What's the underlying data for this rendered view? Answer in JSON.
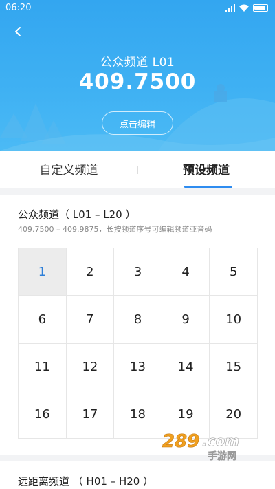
{
  "status": {
    "time": "06:20"
  },
  "header": {
    "channel_title": "公众频道 L01",
    "frequency": "409.7500",
    "edit_label": "点击编辑"
  },
  "tabs": [
    {
      "label": "自定义频道",
      "active": false
    },
    {
      "label": "预设频道",
      "active": true
    }
  ],
  "public_section": {
    "title": "公众频道（ L01 – L20 ）",
    "subtitle": "409.7500 – 409.9875，长按频道序号可编辑频道亚音码",
    "channels": [
      "1",
      "2",
      "3",
      "4",
      "5",
      "6",
      "7",
      "8",
      "9",
      "10",
      "11",
      "12",
      "13",
      "14",
      "15",
      "16",
      "17",
      "18",
      "19",
      "20"
    ],
    "selected": "1"
  },
  "long_range_section": {
    "title": "远距离频道 （ H01 – H20 ）"
  },
  "watermark": {
    "text": "289.com",
    "sub": "手游网"
  },
  "colors": {
    "header_blue": "#33a6f0",
    "accent": "#2e8cf0"
  }
}
